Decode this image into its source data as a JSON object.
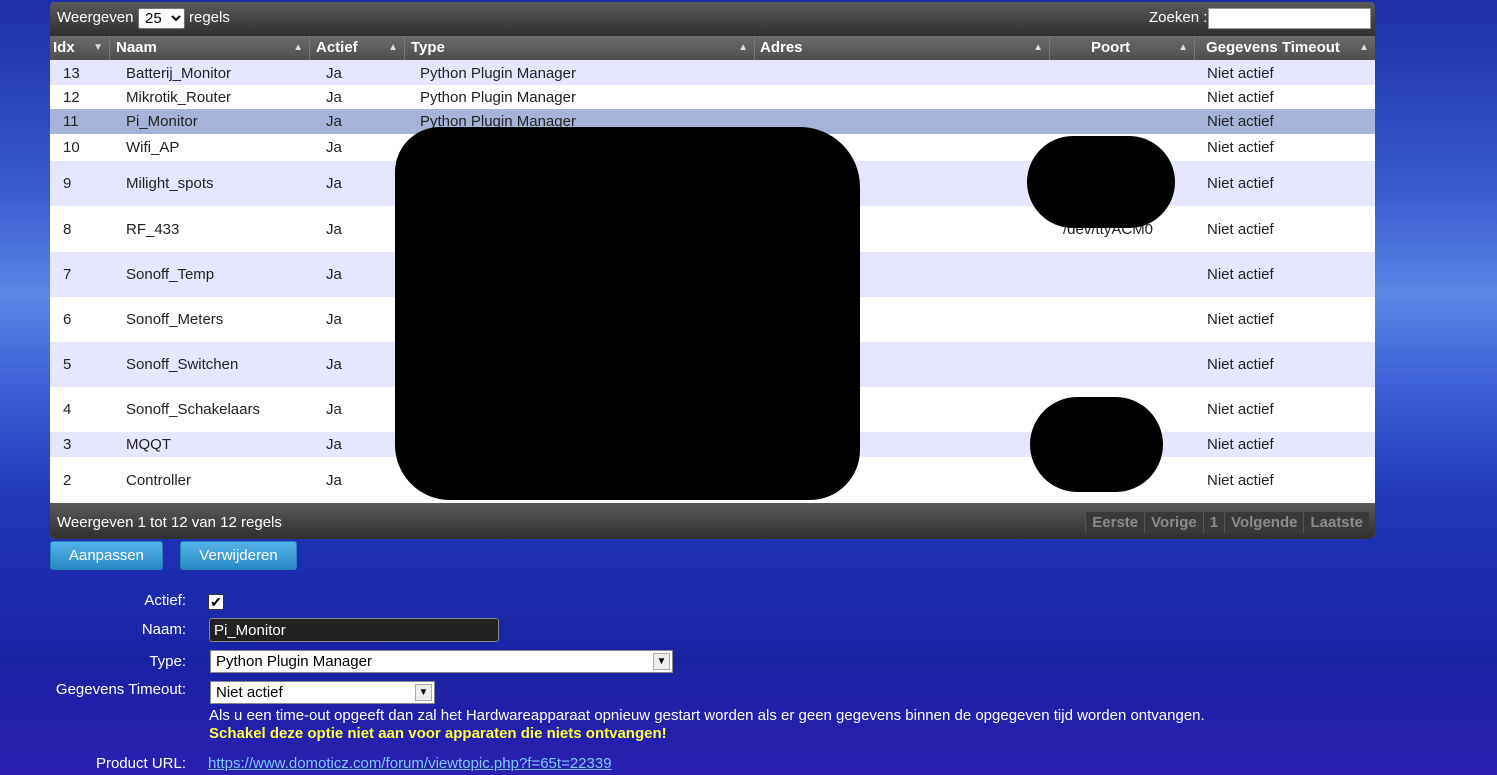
{
  "table_controls": {
    "show_label": "Weergeven",
    "page_size": "25",
    "rows_label": "regels",
    "search_label": "Zoeken :",
    "search_value": ""
  },
  "columns": [
    "Idx",
    "Naam",
    "Actief",
    "Type",
    "Adres",
    "Poort",
    "Gegevens Timeout"
  ],
  "rows": [
    {
      "idx": "13",
      "naam": "Batterij_Monitor",
      "actief": "Ja",
      "type": "Python Plugin Manager",
      "adres": "",
      "poort": "",
      "timeout": "Niet actief"
    },
    {
      "idx": "12",
      "naam": "Mikrotik_Router",
      "actief": "Ja",
      "type": "Python Plugin Manager",
      "adres": "",
      "poort": "",
      "timeout": "Niet actief"
    },
    {
      "idx": "11",
      "naam": "Pi_Monitor",
      "actief": "Ja",
      "type": "Python Plugin Manager",
      "adres": "",
      "poort": "",
      "timeout": "Niet actief"
    },
    {
      "idx": "10",
      "naam": "Wifi_AP",
      "actief": "Ja",
      "type": "",
      "adres": "",
      "poort": "",
      "timeout": "Niet actief"
    },
    {
      "idx": "9",
      "naam": "Milight_spots",
      "actief": "Ja",
      "type": "",
      "adres": "",
      "poort": "",
      "timeout": "Niet actief"
    },
    {
      "idx": "8",
      "naam": "RF_433",
      "actief": "Ja",
      "type": "",
      "adres": "",
      "poort": "/dev/ttyACM0",
      "timeout": "Niet actief"
    },
    {
      "idx": "7",
      "naam": "Sonoff_Temp",
      "actief": "Ja",
      "type": "",
      "adres": "",
      "poort": "",
      "timeout": "Niet actief"
    },
    {
      "idx": "6",
      "naam": "Sonoff_Meters",
      "actief": "Ja",
      "type": "",
      "adres": "",
      "poort": "",
      "timeout": "Niet actief"
    },
    {
      "idx": "5",
      "naam": "Sonoff_Switchen",
      "actief": "Ja",
      "type": "",
      "adres": "",
      "poort": "",
      "timeout": "Niet actief"
    },
    {
      "idx": "4",
      "naam": "Sonoff_Schakelaars",
      "actief": "Ja",
      "type": "",
      "adres": "",
      "poort": "",
      "timeout": "Niet actief"
    },
    {
      "idx": "3",
      "naam": "MQQT",
      "actief": "Ja",
      "type": "",
      "adres": "",
      "poort": "",
      "timeout": "Niet actief"
    },
    {
      "idx": "2",
      "naam": "Controller",
      "actief": "Ja",
      "type": "",
      "adres": "",
      "poort": "",
      "timeout": "Niet actief"
    }
  ],
  "footer": {
    "info": "Weergeven 1 tot 12 van 12 regels",
    "pager": [
      "Eerste",
      "Vorige",
      "1",
      "Volgende",
      "Laatste"
    ]
  },
  "buttons": {
    "update": "Aanpassen",
    "delete": "Verwijderen"
  },
  "form": {
    "active_label": "Actief:",
    "active_checked": true,
    "name_label": "Naam:",
    "name_value": "Pi_Monitor",
    "type_label": "Type:",
    "type_value": "Python Plugin Manager",
    "timeout_label": "Gegevens Timeout:",
    "timeout_value": "Niet actief",
    "timeout_note": "Als u een time-out opgeeft dan zal het Hardwareapparaat opnieuw gestart worden als er geen gegevens binnen de opgegeven tijd worden ontvangen.",
    "timeout_warning": "Schakel deze optie niet aan voor apparaten die niets ontvangen!",
    "product_url_label": "Product URL:",
    "product_url": "https://www.domoticz.com/forum/viewtopic.php?f=65t=22339"
  },
  "icons": {
    "sort": "sort-arrow-icon",
    "dropdown": "chevron-down-icon",
    "check": "checkmark-icon"
  },
  "colors": {
    "selected_row": "#a5b4d8",
    "odd_row": "#e6e7ff",
    "button": "#3a9ad7",
    "warning": "#ffff40",
    "link": "#80c8ff"
  }
}
